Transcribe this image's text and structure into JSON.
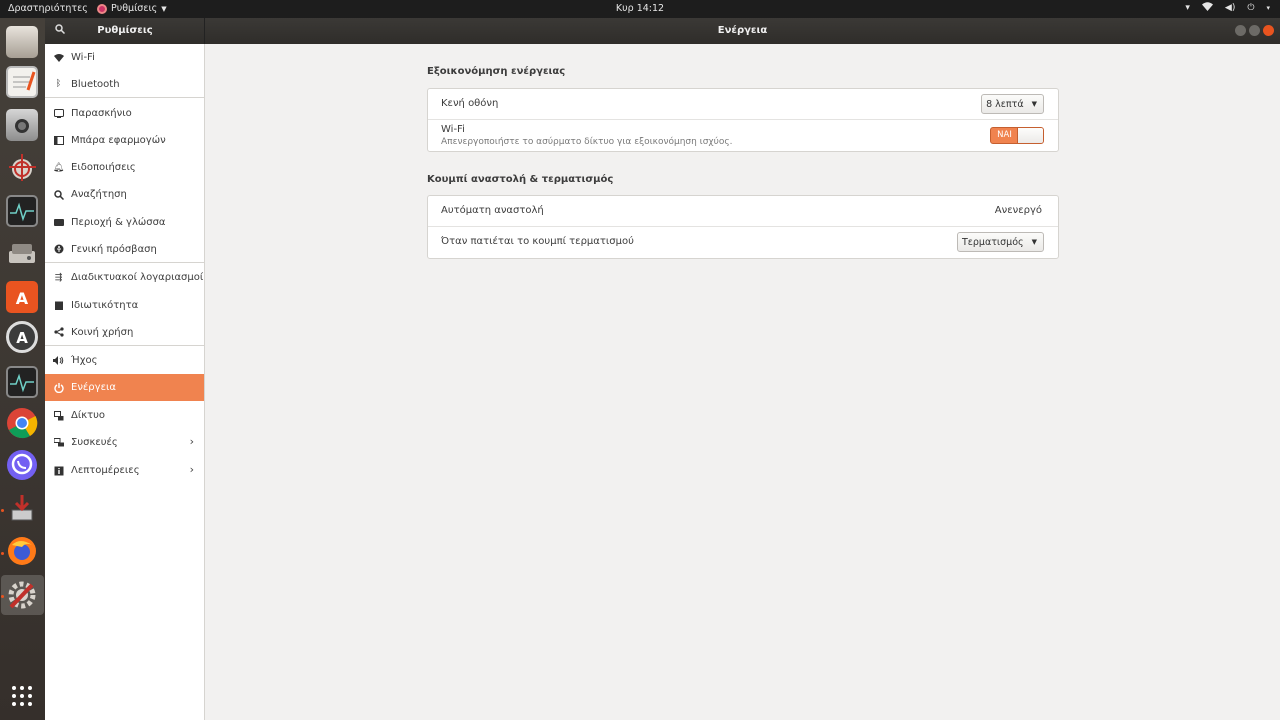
{
  "topbar": {
    "activities": "Δραστηριότητες",
    "app_menu": "Ρυθμίσεις",
    "clock": "Κυρ 14:12"
  },
  "header": {
    "sidebar_title": "Ρυθμίσεις",
    "page_title": "Ενέργεια"
  },
  "sidebar": {
    "items": [
      {
        "label": "Wi-Fi",
        "icon": "wifi-icon"
      },
      {
        "label": "Bluetooth",
        "icon": "bluetooth-icon"
      },
      {
        "label": "Παρασκήνιο",
        "icon": "background-icon"
      },
      {
        "label": "Μπάρα εφαρμογών",
        "icon": "dock-icon"
      },
      {
        "label": "Ειδοποιήσεις",
        "icon": "bell-icon"
      },
      {
        "label": "Αναζήτηση",
        "icon": "search-icon"
      },
      {
        "label": "Περιοχή & γλώσσα",
        "icon": "region-icon"
      },
      {
        "label": "Γενική πρόσβαση",
        "icon": "accessibility-icon"
      },
      {
        "label": "Διαδικτυακοί λογαριασμοί",
        "icon": "online-accounts-icon"
      },
      {
        "label": "Ιδιωτικότητα",
        "icon": "privacy-icon"
      },
      {
        "label": "Κοινή χρήση",
        "icon": "share-icon"
      },
      {
        "label": "Ήχος",
        "icon": "speaker-icon"
      },
      {
        "label": "Ενέργεια",
        "icon": "power-icon"
      },
      {
        "label": "Δίκτυο",
        "icon": "network-icon"
      },
      {
        "label": "Συσκευές",
        "icon": "devices-icon"
      },
      {
        "label": "Λεπτομέρειες",
        "icon": "info-icon"
      }
    ]
  },
  "power_saving": {
    "title": "Εξοικονόμηση ενέργειας",
    "blank_screen_label": "Κενή οθόνη",
    "blank_screen_value": "8 λεπτά",
    "wifi_label": "Wi-Fi",
    "wifi_sub": "Απενεργοποιήστε το ασύρματο δίκτυο για εξοικονόμηση ισχύος.",
    "wifi_switch": "ΝΑΙ"
  },
  "suspend": {
    "title": "Κουμπί αναστολή & τερματισμός",
    "auto_label": "Αυτόματη αναστολή",
    "auto_value": "Ανενεργό",
    "power_button_label": "Όταν πατιέται το κουμπί τερματισμού",
    "power_button_value": "Τερματισμός"
  },
  "colors": {
    "accent": "#f0834f",
    "topbar": "#1d1d1d",
    "background": "#f2f1f0"
  }
}
